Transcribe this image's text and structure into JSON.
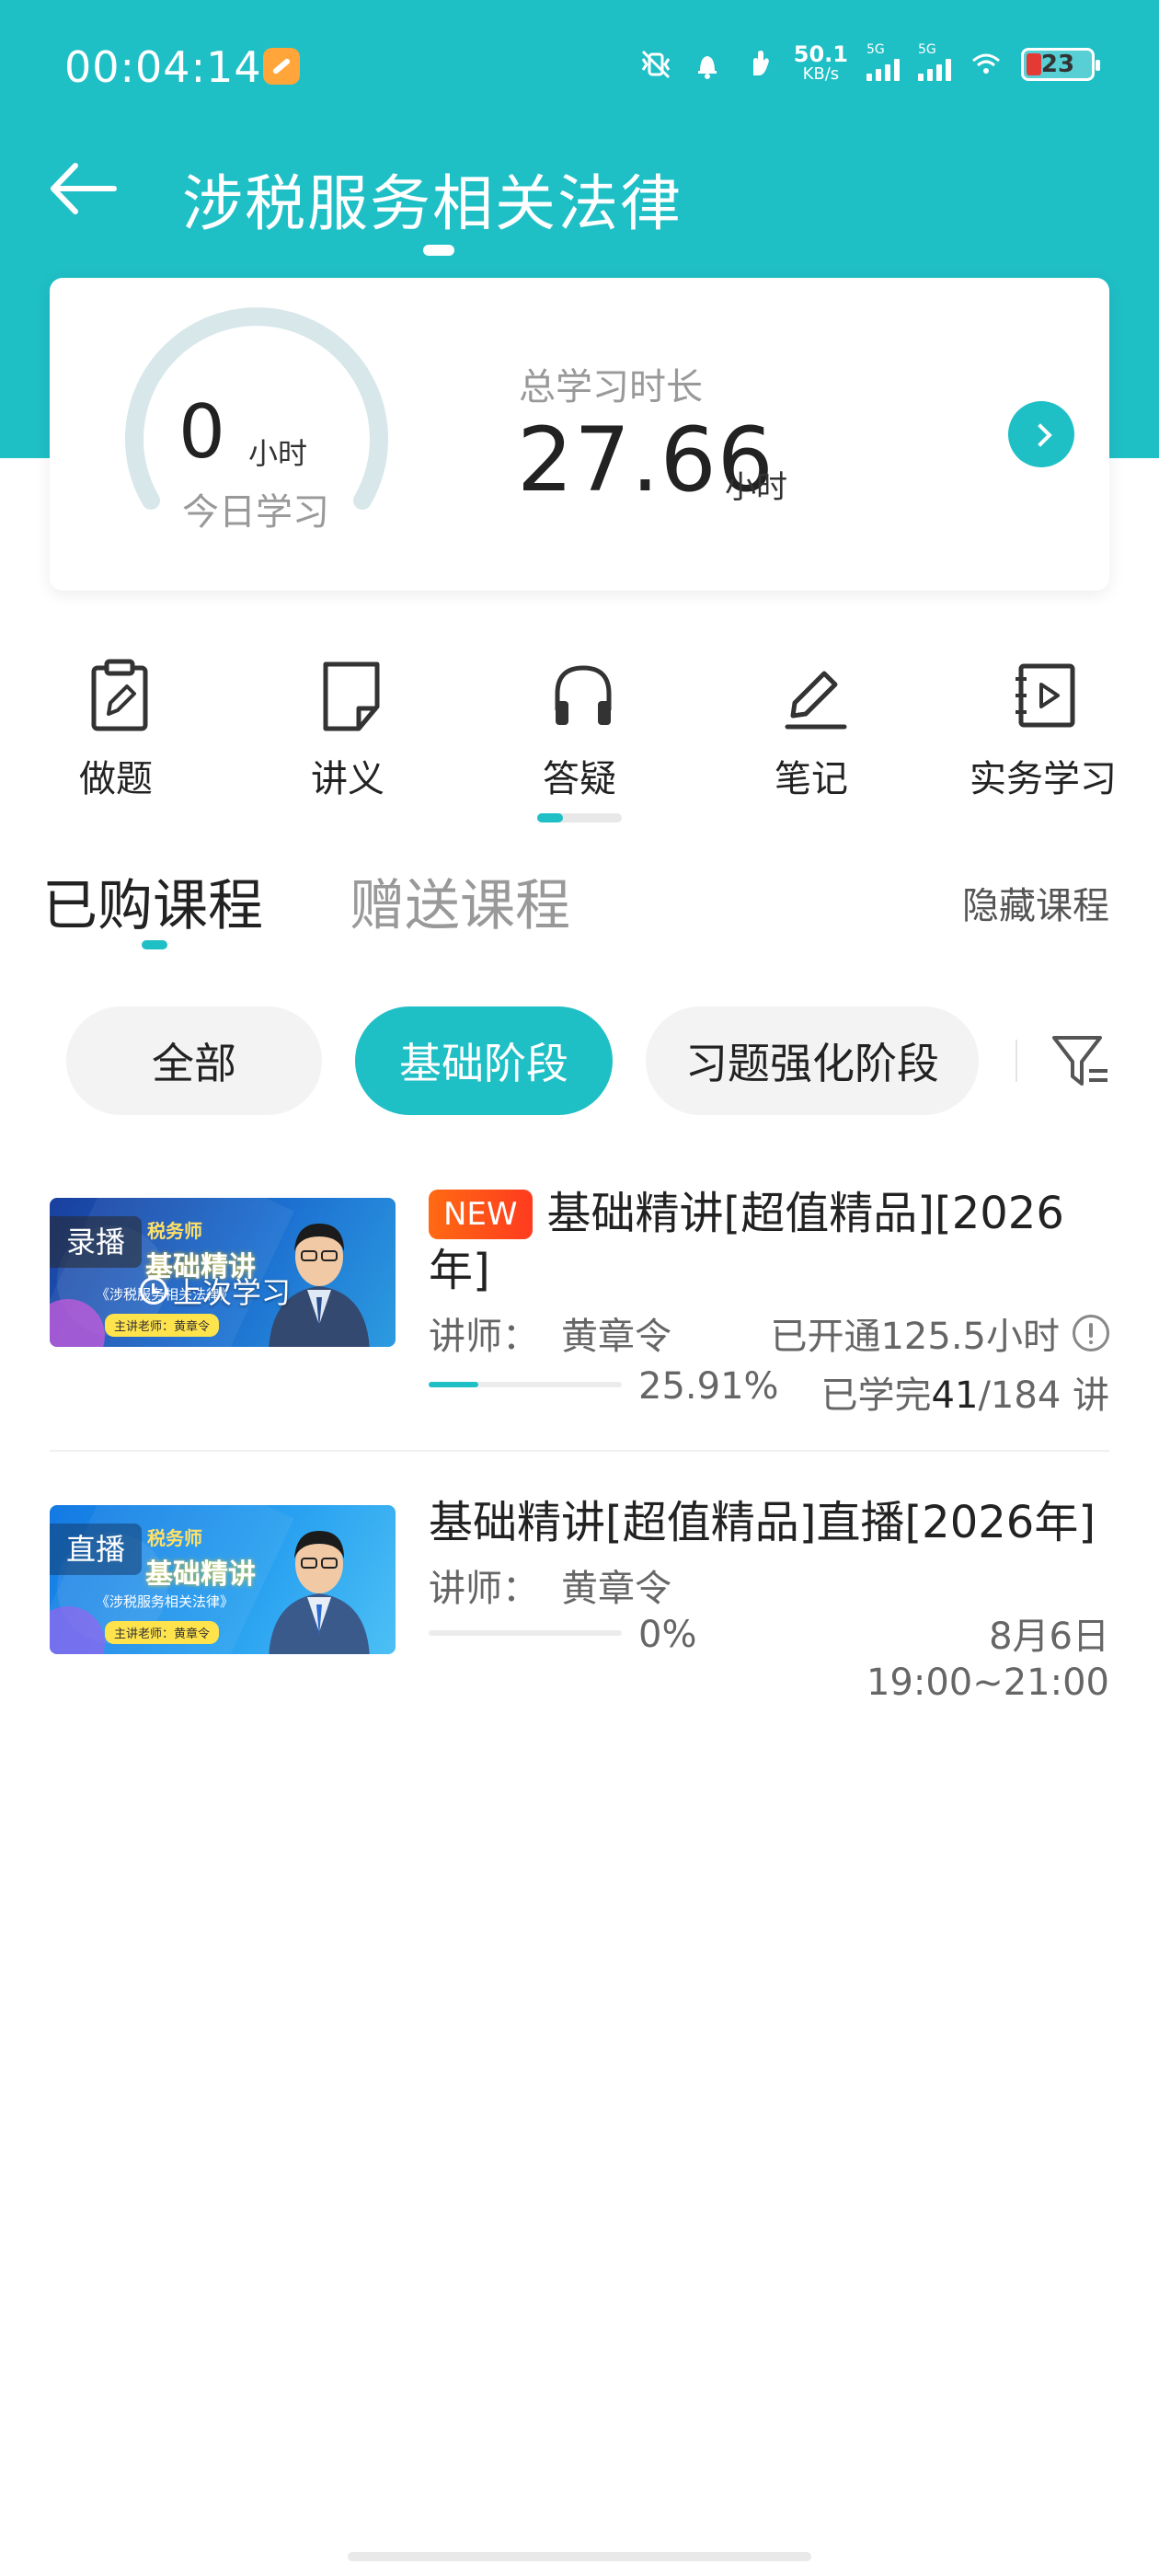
{
  "status_bar": {
    "time": "00:04:14",
    "net_speed_value": "50.1",
    "net_speed_unit": "KB/s",
    "signal_1_label": "5G",
    "signal_2_label": "5G",
    "battery": "23"
  },
  "header": {
    "title": "涉税服务相关法律"
  },
  "study_card": {
    "today_value": "0",
    "today_unit": "小时",
    "today_label": "今日学习",
    "today_progress": 0,
    "total_label": "总学习时长",
    "total_value": "27.66",
    "total_unit": "小时"
  },
  "quick_nav": {
    "items": [
      {
        "label": "做题",
        "icon": "clipboard-edit-icon"
      },
      {
        "label": "讲义",
        "icon": "document-icon"
      },
      {
        "label": "答疑",
        "icon": "headphones-icon"
      },
      {
        "label": "笔记",
        "icon": "pencil-icon"
      },
      {
        "label": "实务学习",
        "icon": "video-play-icon"
      }
    ]
  },
  "course_tabs": {
    "purchased": "已购课程",
    "gifted": "赠送课程",
    "hide": "隐藏课程"
  },
  "filters": {
    "chips": [
      "全部",
      "基础阶段",
      "习题强化阶段"
    ],
    "selected": "基础阶段"
  },
  "courses": [
    {
      "tag": "录播",
      "badge": "NEW",
      "title": "基础精讲[超值精品][2026年]",
      "teacher_label": "讲师：",
      "teacher": "黄章令",
      "last_study": "上次学习",
      "opened": "已开通125.5小时",
      "progress": 25.91,
      "progress_text": "25.91%",
      "lectures_prefix": "已学完",
      "lectures_done": "41",
      "lectures_total": "/184 讲",
      "thumb_line1": "税务师",
      "thumb_line2": "基础精讲",
      "thumb_line3": "《涉税服务相关法律》",
      "thumb_line4": "主讲老师：黄章令"
    },
    {
      "tag": "直播",
      "title": "基础精讲[超值精品]直播[2026年]",
      "teacher_label": "讲师：",
      "teacher": "黄章令",
      "progress": 0,
      "progress_text": "0%",
      "date": "8月6日",
      "time": "19:00~21:00",
      "thumb_line1": "税务师",
      "thumb_line2": "基础精讲",
      "thumb_line3": "《涉税服务相关法律》",
      "thumb_line4": "主讲老师：黄章令"
    }
  ],
  "colors": {
    "accent": "#1fbfc6",
    "new_badge": "#ff4a1c"
  }
}
